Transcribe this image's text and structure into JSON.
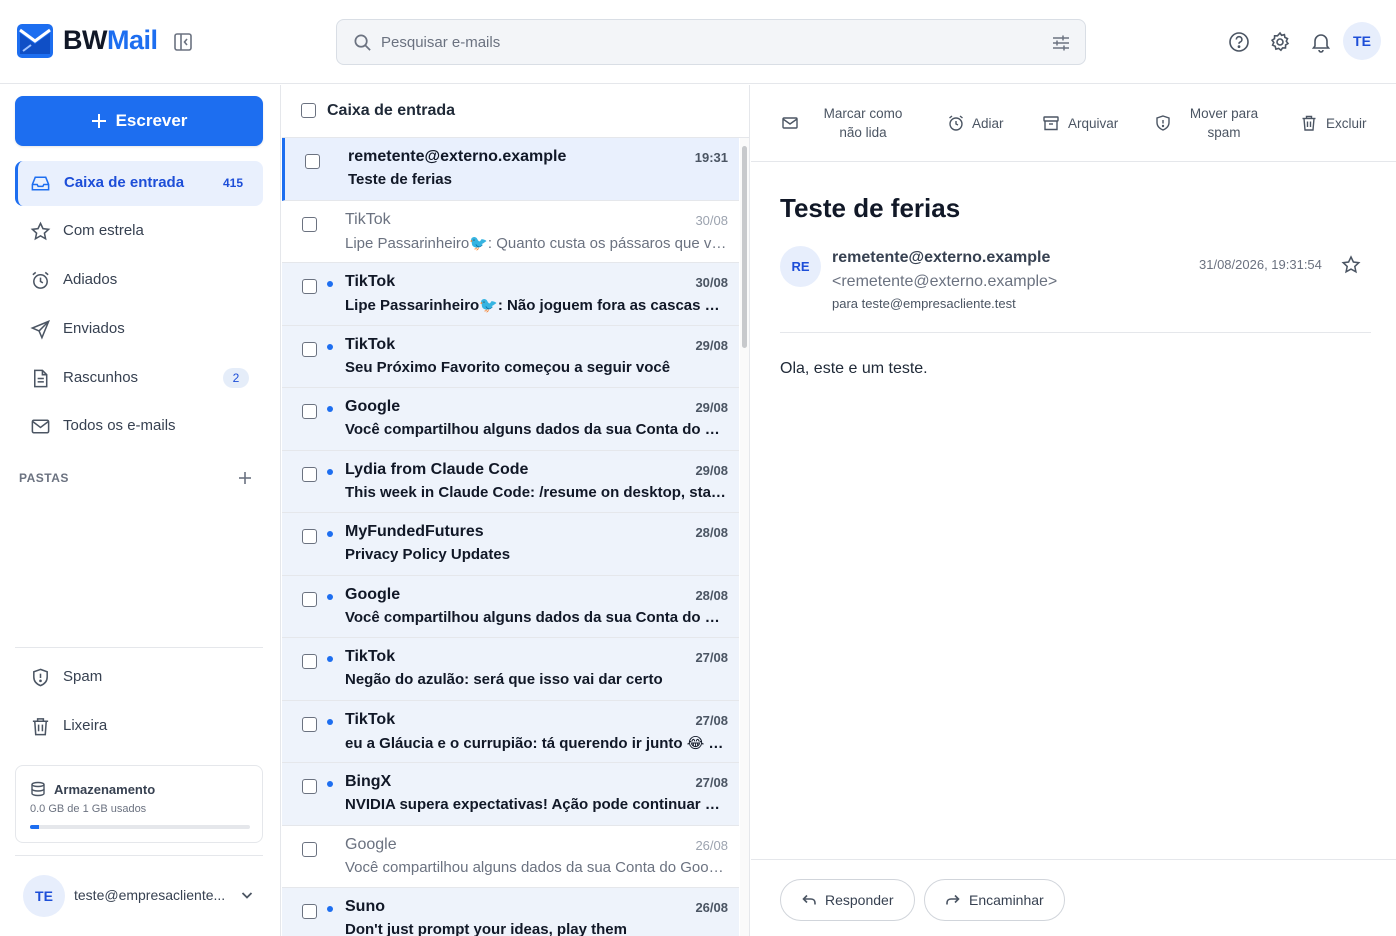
{
  "app": {
    "brand_part1": "BW",
    "brand_part2": "Mail",
    "accent_color": "#1d6ef0"
  },
  "search": {
    "placeholder": "Pesquisar e-mails",
    "value": ""
  },
  "header": {
    "avatar_initials": "TE",
    "icons": [
      "help-icon",
      "gear-icon",
      "bell-icon"
    ]
  },
  "sidebar": {
    "compose_label": "Escrever",
    "items": [
      {
        "label": "Caixa de entrada",
        "badge": "415",
        "icon": "inbox-icon",
        "active": true
      },
      {
        "label": "Com estrela",
        "badge": "",
        "icon": "star-icon"
      },
      {
        "label": "Adiados",
        "badge": "",
        "icon": "alarm-clock-icon"
      },
      {
        "label": "Enviados",
        "badge": "",
        "icon": "send-icon"
      },
      {
        "label": "Rascunhos",
        "badge": "2",
        "icon": "draft-icon"
      },
      {
        "label": "Todos os e-mails",
        "badge": "",
        "icon": "mail-icon"
      }
    ],
    "folders_title": "PASTAS",
    "bottom_items": [
      {
        "label": "Spam",
        "icon": "shield-alert-icon"
      },
      {
        "label": "Lixeira",
        "icon": "trash-icon"
      }
    ],
    "storage": {
      "title": "Armazenamento",
      "usage_text": "0.0 GB de 1 GB usados",
      "used_fraction": 0.04
    },
    "account": {
      "initials": "TE",
      "email": "teste@empresacliente..."
    }
  },
  "mail_list": {
    "title": "Caixa de entrada",
    "rows": [
      {
        "sender": "remetente@externo.example",
        "subject": "Teste de ferias",
        "date": "19:31",
        "unread": false,
        "selected": true
      },
      {
        "sender": "TikTok",
        "subject": "Lipe Passarinheiro🐦: Quanto custa os pássaros que você tem?",
        "date": "30/08",
        "unread": false
      },
      {
        "sender": "TikTok",
        "subject": "Lipe Passarinheiro🐦: Não joguem fora as cascas de ovo",
        "date": "30/08",
        "unread": true
      },
      {
        "sender": "TikTok",
        "subject": "Seu Próximo Favorito começou a seguir você",
        "date": "29/08",
        "unread": true
      },
      {
        "sender": "Google",
        "subject": "Você compartilhou alguns dados da sua Conta do Google",
        "date": "29/08",
        "unread": true
      },
      {
        "sender": "Lydia from Claude Code",
        "subject": "This week in Claude Code: /resume on desktop, starter skills",
        "date": "29/08",
        "unread": true
      },
      {
        "sender": "MyFundedFutures",
        "subject": "Privacy Policy Updates",
        "date": "28/08",
        "unread": true
      },
      {
        "sender": "Google",
        "subject": "Você compartilhou alguns dados da sua Conta do Google",
        "date": "28/08",
        "unread": true
      },
      {
        "sender": "TikTok",
        "subject": "Negão do azulão: será que isso vai dar certo",
        "date": "27/08",
        "unread": true
      },
      {
        "sender": "TikTok",
        "subject": "eu a Gláucia e o currupião: tá querendo ir junto 😂 haha",
        "date": "27/08",
        "unread": true
      },
      {
        "sender": "BingX",
        "subject": "NVIDIA supera expectativas! Ação pode continuar subindo",
        "date": "27/08",
        "unread": true
      },
      {
        "sender": "Google",
        "subject": "Você compartilhou alguns dados da sua Conta do Google",
        "date": "26/08",
        "unread": false
      },
      {
        "sender": "Suno",
        "subject": "Don't just prompt your ideas, play them",
        "date": "26/08",
        "unread": true
      }
    ]
  },
  "reader": {
    "toolbar": {
      "mark_unread": "Marcar como não lida",
      "snooze": "Adiar",
      "archive": "Arquivar",
      "spam": "Mover para spam",
      "delete": "Excluir"
    },
    "subject": "Teste de ferias",
    "from_initials": "RE",
    "from_name": "remetente@externo.example",
    "from_address": "<remetente@externo.example>",
    "to": "para teste@empresacliente.test",
    "date": "31/08/2026, 19:31:54",
    "body": "Ola, este e um teste.",
    "reply_label": "Responder",
    "forward_label": "Encaminhar"
  }
}
